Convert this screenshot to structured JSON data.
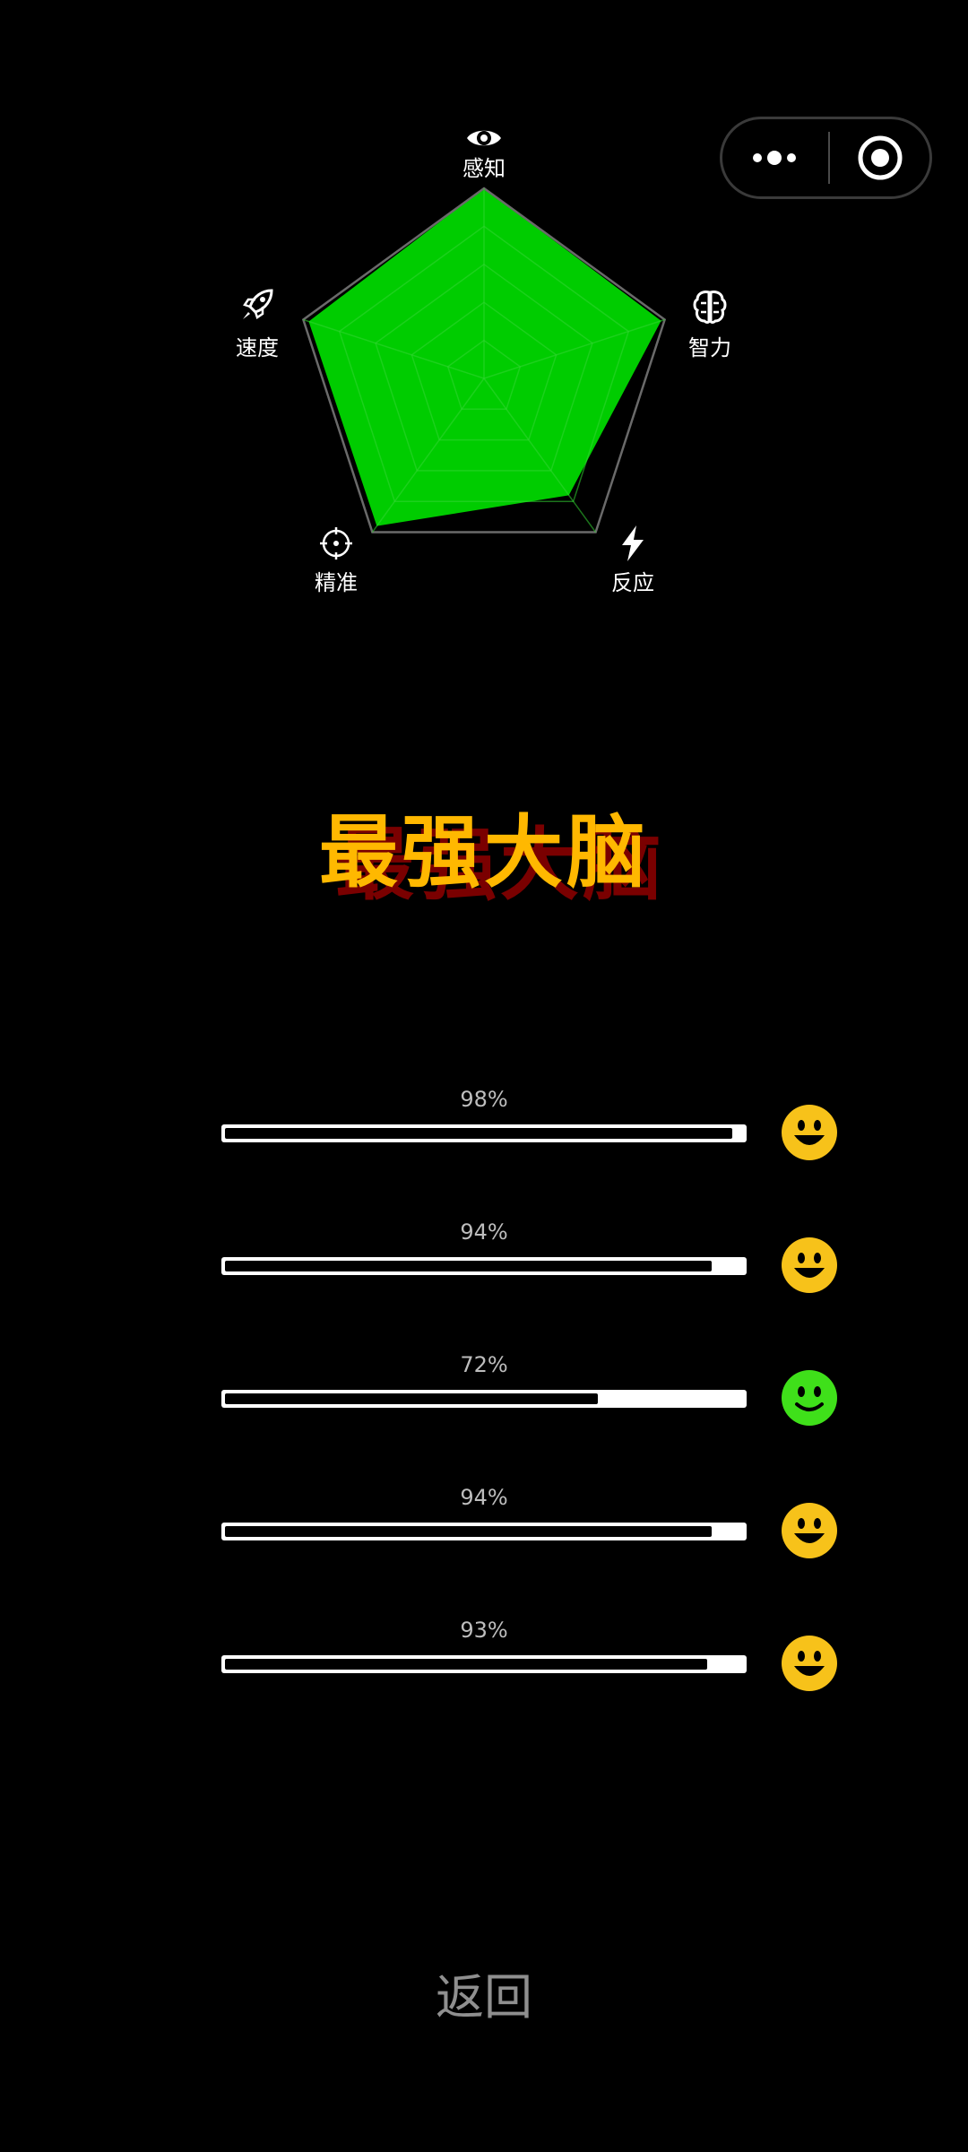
{
  "capsule": {
    "more_icon": "more-dots-icon",
    "close_icon": "target-close-icon"
  },
  "radar": {
    "axes": [
      {
        "label": "感知",
        "icon": "eye-icon",
        "value": 1.0
      },
      {
        "label": "智力",
        "icon": "brain-icon",
        "value": 0.98
      },
      {
        "label": "反应",
        "icon": "lightning-icon",
        "value": 0.76
      },
      {
        "label": "精准",
        "icon": "crosshair-icon",
        "value": 0.96
      },
      {
        "label": "速度",
        "icon": "rocket-icon",
        "value": 0.97
      }
    ],
    "fill_color": "#00cc00",
    "grid_color": "#5a5a5a"
  },
  "title": {
    "text": "最强大脑",
    "color": "#ffb800",
    "shadow_color": "#7a0000"
  },
  "progress": [
    {
      "label": "98%",
      "value": 0.98,
      "face": "big-grin-icon",
      "face_color": "#f7c21a"
    },
    {
      "label": "94%",
      "value": 0.94,
      "face": "big-grin-icon",
      "face_color": "#f7c21a"
    },
    {
      "label": "72%",
      "value": 0.72,
      "face": "smile-icon",
      "face_color": "#3fe01a"
    },
    {
      "label": "94%",
      "value": 0.94,
      "face": "big-grin-icon",
      "face_color": "#f7c21a"
    },
    {
      "label": "93%",
      "value": 0.93,
      "face": "big-grin-icon",
      "face_color": "#f7c21a"
    }
  ],
  "back_label": "返回"
}
